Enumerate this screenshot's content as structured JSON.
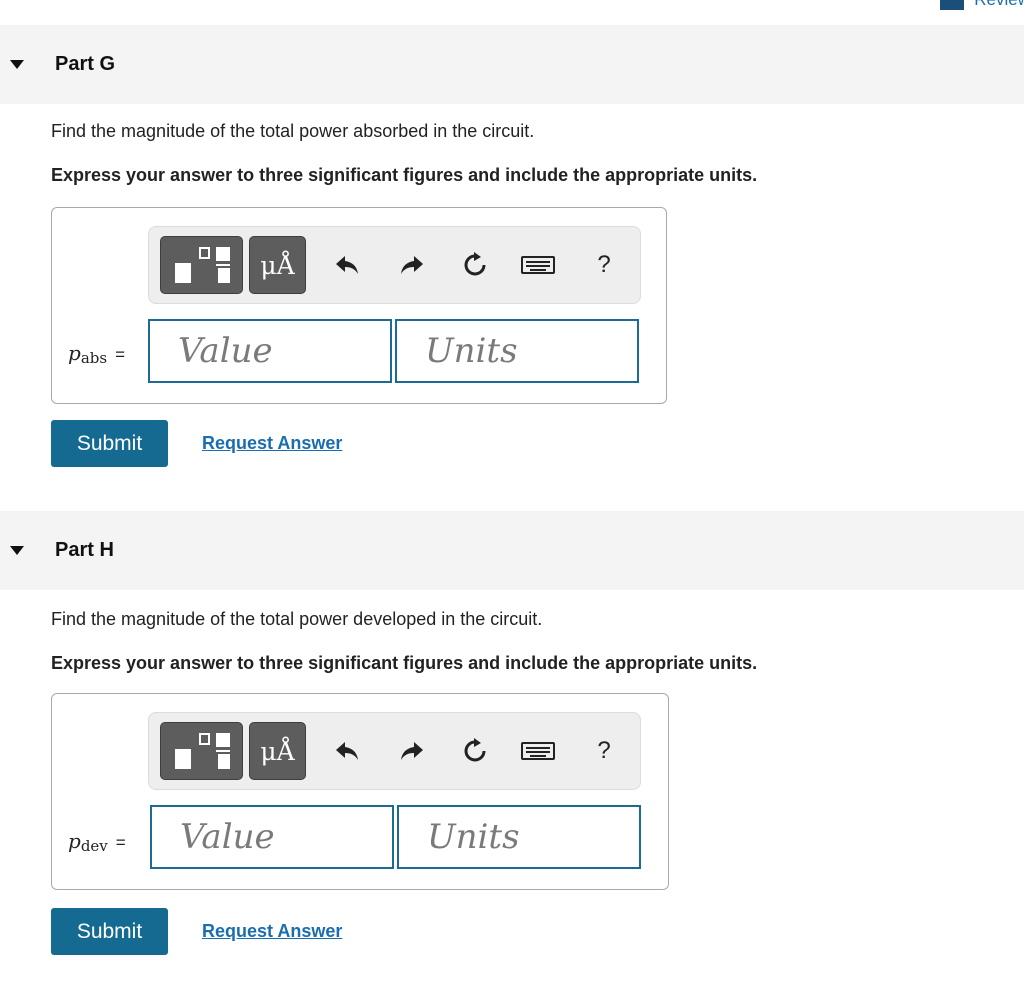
{
  "header": {
    "review_label": "Review"
  },
  "parts": [
    {
      "title": "Part G",
      "prompt": "Find the magnitude of the total power absorbed in the circuit.",
      "instruction": "Express your answer to three significant figures and include the appropriate units.",
      "variable": {
        "symbol": "p",
        "subscript": "abs",
        "equals": "="
      },
      "toolbar": {
        "symbols_label": "μÅ",
        "help_label": "?",
        "icons": [
          "templates-icon",
          "undo-icon",
          "redo-icon",
          "reset-icon",
          "keyboard-icon",
          "help-icon"
        ]
      },
      "value_placeholder": "Value",
      "units_placeholder": "Units",
      "submit_label": "Submit",
      "request_label": "Request Answer"
    },
    {
      "title": "Part H",
      "prompt": "Find the magnitude of the total power developed in the circuit.",
      "instruction": "Express your answer to three significant figures and include the appropriate units.",
      "variable": {
        "symbol": "p",
        "subscript": "dev",
        "equals": "="
      },
      "toolbar": {
        "symbols_label": "μÅ",
        "help_label": "?",
        "icons": [
          "templates-icon",
          "undo-icon",
          "redo-icon",
          "reset-icon",
          "keyboard-icon",
          "help-icon"
        ]
      },
      "value_placeholder": "Value",
      "units_placeholder": "Units",
      "submit_label": "Submit",
      "request_label": "Request Answer"
    }
  ],
  "colors": {
    "accent": "#156a91",
    "link": "#1a6eb0",
    "header_bg": "#f4f4f4",
    "input_border": "#1c6b93"
  }
}
